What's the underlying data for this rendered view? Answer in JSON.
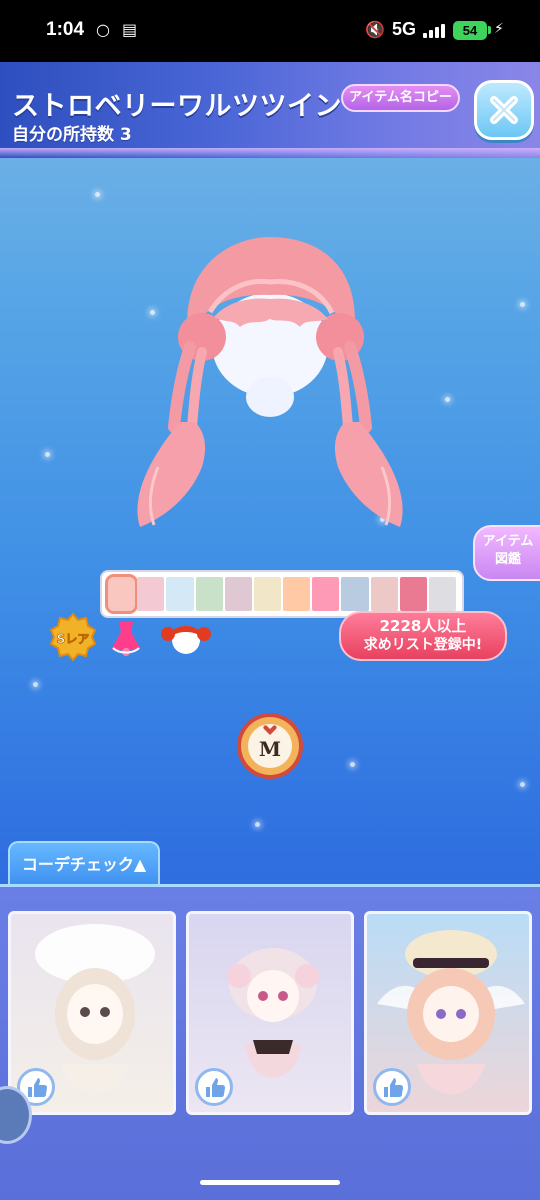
{
  "status_bar": {
    "time": "1:04",
    "network": "5G",
    "battery": "54",
    "icons": [
      "notification-icon",
      "gallery-icon",
      "mute-icon",
      "signal-icon",
      "battery-icon",
      "charging-icon"
    ]
  },
  "header": {
    "title": "ストロベリーワルツツイン",
    "owned_count": "自分の所持数 3",
    "copy_button": "アイテム名コピー",
    "close_icon": "close-icon"
  },
  "side": {
    "zukan_line1": "アイテム",
    "zukan_line2": "図鑑"
  },
  "palette": {
    "colors": [
      "#f9c7c0",
      "#f3c9d3",
      "#d5e8f6",
      "#c9e0c9",
      "#e0c8d2",
      "#f2e6c8",
      "#ffc9a6",
      "#ff9ab6",
      "#b9cbe0",
      "#ecc9c6",
      "#ea7a92",
      "#dedde2"
    ],
    "selected_index": 0
  },
  "badges": {
    "rarity": "Sレア",
    "category_icon": "dress-icon",
    "hair_icon": "hair-icon"
  },
  "wishlist": {
    "line1": "2228人以上",
    "line2": "求めリスト登録中!"
  },
  "m_badge": "M",
  "coord_check": {
    "tab_label": "コーデチェック▲",
    "cards": [
      {
        "name": "coord-card-1",
        "like_icon": "thumbs-up-icon"
      },
      {
        "name": "coord-card-2",
        "like_icon": "thumbs-up-icon"
      },
      {
        "name": "coord-card-3",
        "like_icon": "thumbs-up-icon"
      }
    ]
  }
}
